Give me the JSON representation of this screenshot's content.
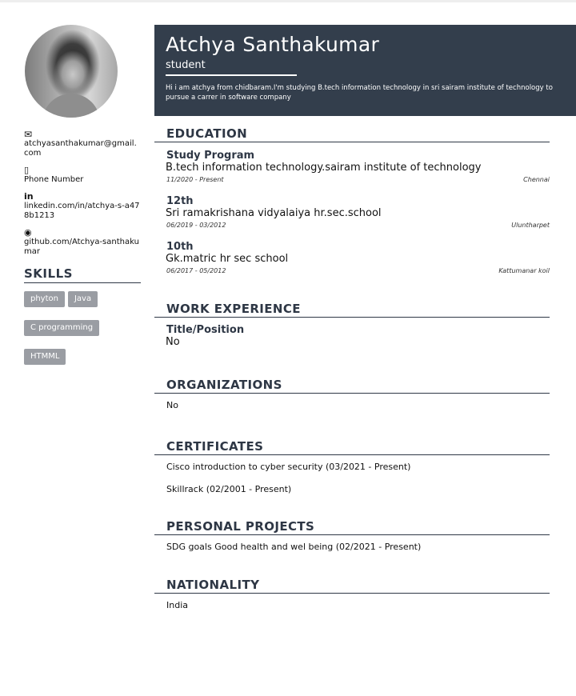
{
  "profile": {
    "name": "Atchya Santhakumar",
    "role": "student",
    "summary": "Hi i am atchya from chidbaram.I'm studying B.tech information technology in sri sairam institute of technology to pursue a carrer in software company"
  },
  "contact": {
    "email": "atchyasanthakumar@gmail.com",
    "phone": "Phone Number",
    "linkedin": "linkedin.com/in/atchya-s-a478b1213",
    "github": "github.com/Atchya-santhakumar"
  },
  "skills": {
    "title": "SKILLS",
    "items": [
      "phyton",
      "Java",
      "C programming",
      "HTMML"
    ]
  },
  "education": {
    "title": "EDUCATION",
    "items": [
      {
        "degree": "Study Program",
        "institution": "B.tech information technology.sairam institute of technology",
        "dates": "11/2020 - Present",
        "location": "Chennai"
      },
      {
        "degree": "12th",
        "institution": "Sri ramakrishana vidyalaiya hr.sec.school",
        "dates": "06/2019 - 03/2012",
        "location": "Uluntharpet"
      },
      {
        "degree": "10th",
        "institution": "Gk.matric hr sec school",
        "dates": "06/2017 - 05/2012",
        "location": "Kattumanar koil"
      }
    ]
  },
  "work": {
    "title": "WORK EXPERIENCE",
    "position_label": "Title/Position",
    "value": "No"
  },
  "organizations": {
    "title": "ORGANIZATIONS",
    "value": "No"
  },
  "certificates": {
    "title": "CERTIFICATES",
    "items": [
      "Cisco introduction to cyber security (03/2021 - Present)",
      "Skillrack (02/2001 - Present)"
    ]
  },
  "projects": {
    "title": "PERSONAL PROJECTS",
    "items": [
      "SDG goals Good health and wel being (02/2021 - Present)"
    ]
  },
  "nationality": {
    "title": "NATIONALITY",
    "value": "India"
  },
  "icons": {
    "email": "mail-icon",
    "phone": "phone-icon",
    "linkedin": "linkedin-icon",
    "github": "github-icon"
  },
  "colors": {
    "header_bg": "#333e4c",
    "accent": "#2e3745",
    "chip_bg": "#9a9da3"
  }
}
